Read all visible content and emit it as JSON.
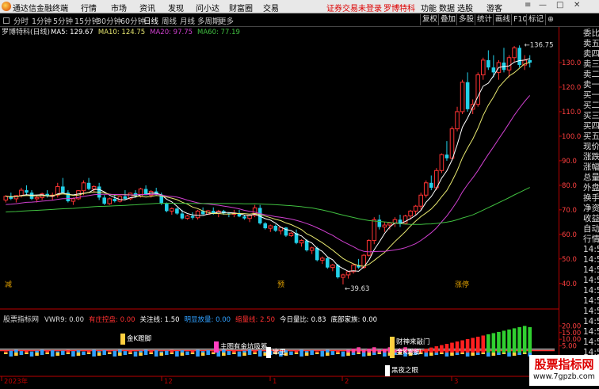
{
  "app": {
    "name": "通达信金融终端"
  },
  "menu": [
    "行情",
    "市场",
    "资讯",
    "发现",
    "问小达",
    "财富圈",
    "交易"
  ],
  "notice": "证券交易未登录",
  "stock_name_top": "罗博特科",
  "menu_right": [
    "功能",
    "数据",
    "选股",
    "游客"
  ],
  "toolbar": {
    "periods": [
      "分时",
      "1分钟",
      "5分钟",
      "15分钟",
      "30分钟",
      "60分钟",
      "日线",
      "周线",
      "月线",
      "多周期",
      "更多"
    ],
    "active_period": "日线",
    "right_buttons": [
      "复权",
      "叠加",
      "多股",
      "统计",
      "画线",
      "F10",
      "标记",
      "⊕"
    ]
  },
  "main_chart": {
    "title": "罗博特科(日线)",
    "ma_labels": [
      {
        "text": "MA5: 129.67",
        "color": "#ffffff"
      },
      {
        "text": "MA10: 124.75",
        "color": "#e8e870"
      },
      {
        "text": "MA20: 97.75",
        "color": "#d040d0"
      },
      {
        "text": "MA60: 77.19",
        "color": "#40c040"
      }
    ],
    "price_ticks": [
      "130.0",
      "120.0",
      "110.0",
      "100.0",
      "90.0",
      "80.0",
      "70.0",
      "60.0",
      "50.0",
      "40.0"
    ],
    "high_label": "136.75",
    "low_label": "39.63",
    "event_markers": [
      {
        "text": "减",
        "color": "#e0a000"
      },
      {
        "text": "预",
        "color": "#e0a000"
      },
      {
        "text": "涨停",
        "color": "#e0a000"
      }
    ]
  },
  "indicator": {
    "name": "股票指标网",
    "values": [
      {
        "text": "VWR9: 0.00",
        "color": "#dddddd"
      },
      {
        "text": "有庄控盘: 0.00",
        "color": "#ff3030"
      },
      {
        "text": "关注线: 1.50",
        "color": "#ffffff"
      },
      {
        "text": "明显放量: 0.00",
        "color": "#30a0ff"
      },
      {
        "text": "缩量线: 2.50",
        "color": "#ff3030"
      },
      {
        "text": "今日量比: 0.83",
        "color": "#ffffff"
      },
      {
        "text": "底部家族: 0.00",
        "color": "#ffffff"
      }
    ],
    "ticks": [
      "20.00",
      "15.00",
      "10.00",
      "5.00"
    ],
    "annotations": [
      "金K蹬脚",
      "主图有金坑吸筹",
      "串里",
      "财神来敲门",
      "金K蹬脚",
      "黑夜之眼"
    ]
  },
  "date_axis": {
    "labels": [
      "2023年",
      "12",
      "1",
      "2",
      "3"
    ]
  },
  "right_panel": {
    "items": [
      "委比",
      "卖五",
      "卖四",
      "卖三",
      "卖二",
      "卖一",
      "买一",
      "买二",
      "买三",
      "买四",
      "买五",
      "现价",
      "涨跌",
      "涨幅",
      "总量",
      "外盘",
      "换手",
      "净资",
      "收益",
      "自动",
      "行情",
      "14:50",
      "14:50",
      "14:50",
      "14:50",
      "14:50",
      "14:50",
      "14:50",
      "14:50",
      "14:50",
      "14:50",
      "14:50"
    ]
  },
  "watermark": {
    "line1": "股票指标网",
    "line2": "www.7gpzb.com"
  },
  "chart_data": {
    "type": "candlestick",
    "title": "罗博特科(日线)",
    "ylim": [
      38,
      140
    ],
    "candles": [
      [
        74,
        76,
        73,
        75.5
      ],
      [
        75.5,
        77,
        74,
        74.5
      ],
      [
        74.5,
        76,
        73,
        75.8
      ],
      [
        75.8,
        79,
        75,
        78
      ],
      [
        78,
        80,
        76,
        77
      ],
      [
        77,
        78,
        74,
        74.5
      ],
      [
        74.5,
        76,
        73,
        75
      ],
      [
        75,
        77,
        74,
        76.5
      ],
      [
        76.5,
        78,
        75,
        75.5
      ],
      [
        75.5,
        77,
        74,
        76
      ],
      [
        76,
        81,
        75,
        79.5
      ],
      [
        79.5,
        83,
        78,
        77
      ],
      [
        77,
        78,
        73,
        73.5
      ],
      [
        73.5,
        75,
        72,
        74.5
      ],
      [
        74.5,
        78,
        74,
        77.8
      ],
      [
        77.8,
        82,
        76,
        81
      ],
      [
        81,
        83,
        78,
        78.5
      ],
      [
        78.5,
        80,
        77,
        79.5
      ],
      [
        79.5,
        81,
        74,
        75
      ],
      [
        75,
        76,
        72,
        72.5
      ],
      [
        72.5,
        75,
        72,
        74.5
      ],
      [
        74.5,
        76,
        73,
        73.5
      ],
      [
        73.5,
        76,
        73,
        75.5
      ],
      [
        75.5,
        78,
        74,
        74.5
      ],
      [
        74.5,
        77,
        74,
        76.8
      ],
      [
        76.8,
        78,
        75,
        75.5
      ],
      [
        75.5,
        79,
        75,
        78.5
      ],
      [
        78.5,
        80,
        76,
        76
      ],
      [
        76,
        78,
        75,
        77.5
      ],
      [
        77.5,
        79,
        76,
        76.2
      ],
      [
        76.2,
        77,
        72,
        72.5
      ],
      [
        72.5,
        73,
        69,
        69.5
      ],
      [
        69.5,
        71,
        68,
        70.5
      ],
      [
        70.5,
        71,
        68,
        68.5
      ],
      [
        68.5,
        70,
        66,
        66.5
      ],
      [
        66.5,
        68,
        66,
        67.5
      ],
      [
        67.5,
        69,
        66,
        66.8
      ],
      [
        66.8,
        70,
        66,
        69.5
      ],
      [
        69.5,
        71,
        68,
        68.2
      ],
      [
        68.2,
        70,
        68,
        69.6
      ],
      [
        69.6,
        71,
        68,
        68.5
      ],
      [
        68.5,
        70,
        67,
        69.5
      ],
      [
        69.5,
        70,
        68,
        68.6
      ],
      [
        68.6,
        69,
        67,
        68.2
      ],
      [
        68.2,
        70,
        67,
        68.7
      ],
      [
        68.7,
        70,
        67,
        67.3
      ],
      [
        67.3,
        68,
        66,
        66.5
      ],
      [
        66.5,
        68,
        65,
        67.8
      ],
      [
        67.8,
        72,
        67,
        70.8
      ],
      [
        70.8,
        72,
        64,
        64.5
      ],
      [
        64.5,
        65,
        62,
        62.5
      ],
      [
        62.5,
        64,
        61,
        63.5
      ],
      [
        63.5,
        64,
        61,
        61.5
      ],
      [
        61.5,
        63,
        60,
        62.8
      ],
      [
        62.8,
        63,
        59,
        59.5
      ],
      [
        59.5,
        61,
        59,
        60.5
      ],
      [
        60.5,
        62,
        56,
        56.5
      ],
      [
        56.5,
        58,
        55,
        57.5
      ],
      [
        57.5,
        58,
        53,
        53.5
      ],
      [
        53.5,
        55,
        52,
        54.5
      ],
      [
        54.5,
        55,
        49,
        49.5
      ],
      [
        49.5,
        51,
        48,
        50.3
      ],
      [
        50.3,
        51,
        46,
        46.5
      ],
      [
        46.5,
        48,
        45,
        47.5
      ],
      [
        47.5,
        48,
        42,
        42.5
      ],
      [
        42.5,
        44,
        39.6,
        43.5
      ],
      [
        43.5,
        45,
        42,
        44.8
      ],
      [
        44.8,
        48,
        44,
        47.5
      ],
      [
        47.5,
        50,
        46,
        46.5
      ],
      [
        46.5,
        52,
        46,
        51.5
      ],
      [
        51.5,
        58,
        51,
        57.5
      ],
      [
        57.5,
        67,
        56,
        66
      ],
      [
        66,
        68,
        62,
        63
      ],
      [
        63,
        65,
        61,
        63.8
      ],
      [
        63.8,
        65,
        62,
        64.6
      ],
      [
        64.6,
        67,
        63,
        66
      ],
      [
        66,
        68,
        63,
        64.5
      ],
      [
        64.5,
        68,
        64,
        67.5
      ],
      [
        67.5,
        70,
        66,
        69.5
      ],
      [
        69.5,
        72,
        68,
        71.5
      ],
      [
        71.5,
        77,
        70,
        76
      ],
      [
        76,
        82,
        75,
        81
      ],
      [
        81,
        84,
        78,
        79
      ],
      [
        79,
        87,
        78,
        86
      ],
      [
        86,
        93,
        85,
        92.5
      ],
      [
        92.5,
        98,
        90,
        91
      ],
      [
        91,
        104,
        90,
        103
      ],
      [
        103,
        112,
        102,
        110
      ],
      [
        110,
        123,
        109,
        122
      ],
      [
        122,
        126,
        110,
        111
      ],
      [
        111,
        115,
        109,
        113
      ],
      [
        113,
        126,
        112,
        125
      ],
      [
        125,
        132,
        123,
        131
      ],
      [
        131,
        135,
        127,
        128
      ],
      [
        128,
        133,
        124,
        126
      ],
      [
        126,
        131,
        123,
        130
      ],
      [
        130,
        136,
        126,
        127
      ],
      [
        127,
        133,
        124,
        132
      ],
      [
        132,
        136.75,
        130,
        136
      ],
      [
        136,
        137,
        128,
        129
      ],
      [
        129,
        133,
        127,
        131
      ],
      [
        131,
        133,
        128,
        130
      ]
    ],
    "series": [
      {
        "name": "MA5",
        "color": "#ffffff"
      },
      {
        "name": "MA10",
        "color": "#e8e870"
      },
      {
        "name": "MA20",
        "color": "#d040d0"
      },
      {
        "name": "MA60",
        "color": "#40c040"
      }
    ],
    "annotations": {
      "high": 136.75,
      "low": 39.63
    }
  }
}
